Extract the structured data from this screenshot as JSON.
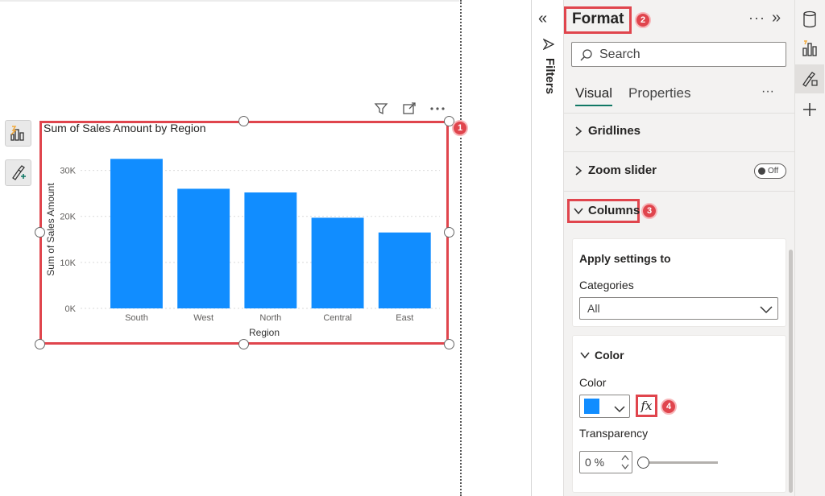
{
  "chart_data": {
    "type": "bar",
    "title": "Sum of Sales Amount by Region",
    "xlabel": "Region",
    "ylabel": "Sum of Sales Amount",
    "categories": [
      "South",
      "West",
      "North",
      "Central",
      "East"
    ],
    "values": [
      32500,
      26000,
      25200,
      19700,
      16500
    ],
    "yticks": [
      0,
      10000,
      20000,
      30000
    ],
    "ytick_labels": [
      "0K",
      "10K",
      "20K",
      "30K"
    ],
    "ylim": [
      0,
      35000
    ],
    "grid": true,
    "color": "#118dff"
  },
  "canvas": {
    "visual_badge": "1",
    "side_tools": [
      "build-visual-icon",
      "format-visual-icon"
    ]
  },
  "filters": {
    "label": "Filters"
  },
  "format_pane": {
    "title": "Format",
    "title_badge": "2",
    "search_placeholder": "Search",
    "tabs": [
      "Visual",
      "Properties"
    ],
    "sections": {
      "gridlines": "Gridlines",
      "zoom_slider": "Zoom slider",
      "zoom_toggle": "Off",
      "columns": "Columns",
      "columns_badge": "3"
    },
    "apply_settings": {
      "heading": "Apply settings to",
      "categories_label": "Categories",
      "categories_value": "All"
    },
    "color_card": {
      "heading": "Color",
      "color_label": "Color",
      "fx_label": "fx",
      "fx_badge": "4",
      "transparency_label": "Transparency",
      "transparency_value": "0 %"
    }
  },
  "colors": {
    "accent": "#117865",
    "highlight": "#e0454d",
    "bar": "#118dff"
  }
}
